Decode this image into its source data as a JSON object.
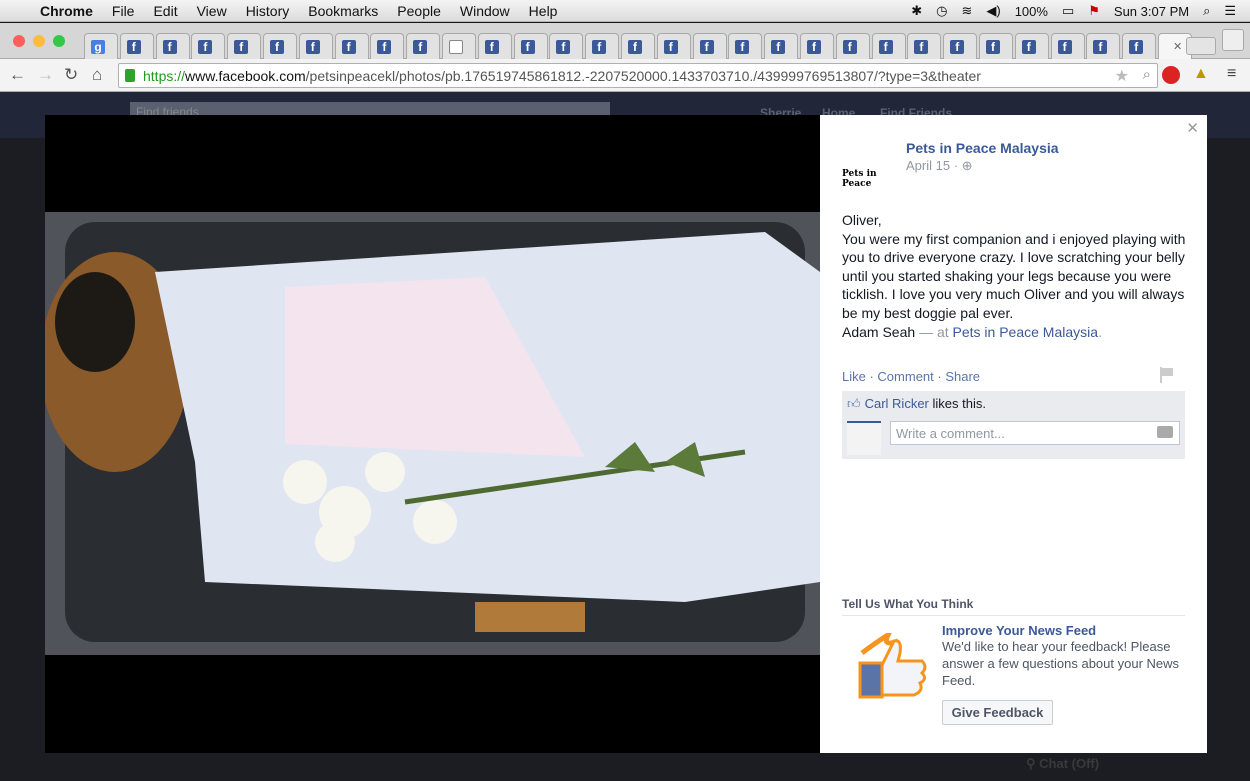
{
  "menubar": {
    "app": "Chrome",
    "items": [
      "File",
      "Edit",
      "View",
      "History",
      "Bookmarks",
      "People",
      "Window",
      "Help"
    ],
    "battery": "100%",
    "clock": "Sun 3:07 PM"
  },
  "tabs": [
    "google",
    "facebook",
    "facebook",
    "facebook",
    "facebook",
    "facebook",
    "facebook",
    "facebook",
    "facebook",
    "facebook",
    "document",
    "facebook",
    "facebook",
    "facebook",
    "facebook",
    "facebook",
    "facebook",
    "facebook",
    "facebook",
    "facebook",
    "facebook",
    "facebook",
    "facebook",
    "facebook",
    "facebook",
    "facebook",
    "facebook",
    "facebook",
    "facebook",
    "facebook"
  ],
  "address": {
    "scheme": "https://",
    "host": "www.facebook.com",
    "path": "/petsinpeacekl/photos/pb.176519745861812.-2207520000.1433703710./439999769513807/?type=3&theater"
  },
  "fb_header": {
    "search_placeholder": "Find friends",
    "user": "Sherrie",
    "home": "Home",
    "find_friends": "Find Friends"
  },
  "post": {
    "page_name": "Pets in Peace Malaysia",
    "logo_text": "Pets in Peace",
    "date": "April 15",
    "lines": [
      "Oliver,",
      "You were my first companion and i enjoyed playing with you to drive everyone crazy. I love scratching your belly until you started shaking your legs because you were ticklish. I love you very much Oliver and you will always be my best doggie pal ever."
    ],
    "author": "Adam Seah",
    "at": "— at",
    "location": "Pets in Peace Malaysia",
    "like": "Like",
    "comment": "Comment",
    "share": "Share",
    "liker": "Carl Ricker",
    "likes_suffix": "likes this.",
    "comment_placeholder": "Write a comment..."
  },
  "feedback": {
    "heading": "Tell Us What You Think",
    "title": "Improve Your News Feed",
    "desc": "We'd like to hear your feedback! Please answer a few questions about your News Feed.",
    "button": "Give Feedback"
  },
  "chat": "Chat (Off)",
  "colors": {
    "facebook_blue": "#3b5998",
    "link": "#5b74a8"
  }
}
